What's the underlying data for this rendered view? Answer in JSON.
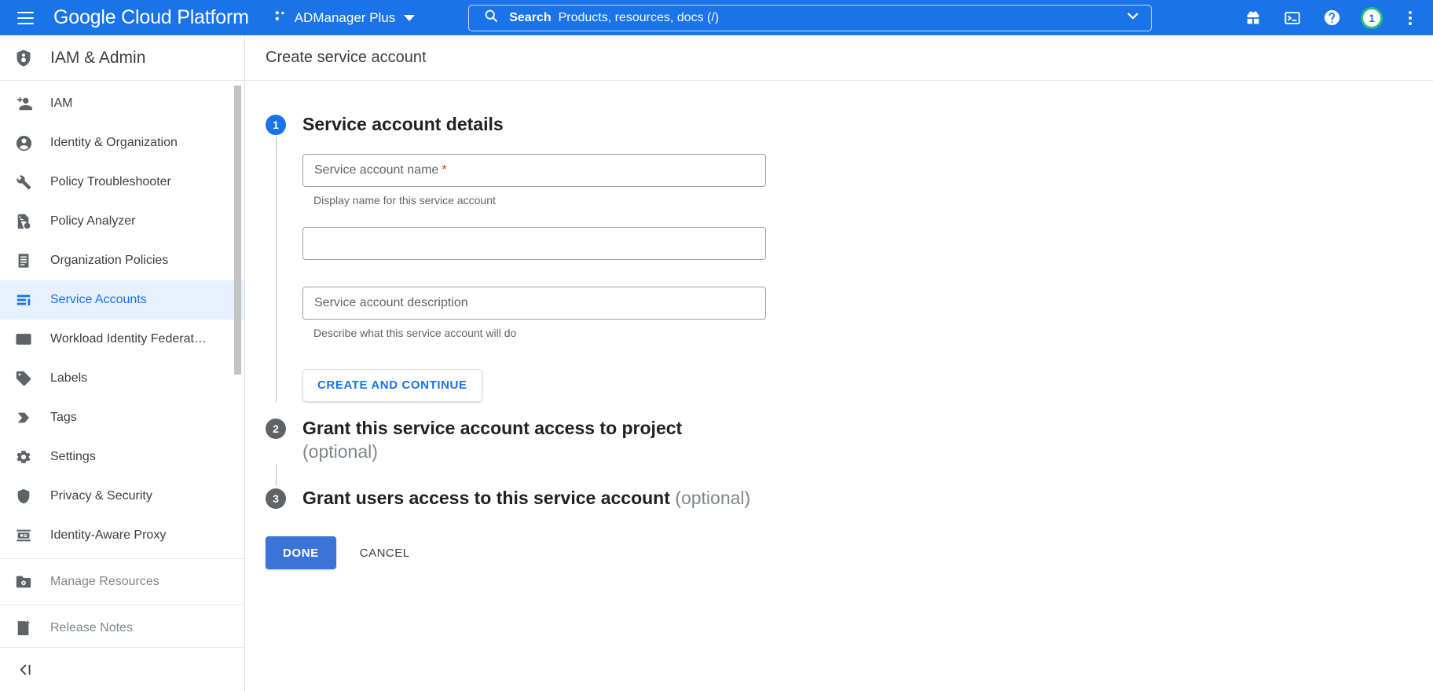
{
  "topbar": {
    "menu_icon": "hamburger-menu-icon",
    "brand": "Google Cloud Platform",
    "project": {
      "icon": "project-selector-icon",
      "name": "ADManager Plus",
      "caret": "chevron-down-icon"
    },
    "search": {
      "icon": "search-icon",
      "label": "Search",
      "placeholder": "Products, resources, docs (/)",
      "dropdown_icon": "chevron-down-icon"
    },
    "icons": [
      {
        "name": "gift-icon"
      },
      {
        "name": "cloud-shell-terminal-icon"
      },
      {
        "name": "help-icon"
      },
      {
        "name": "more-options-kebab-icon"
      }
    ],
    "avatar": {
      "name": "account-avatar",
      "text": "1",
      "ring_color": "#24c277"
    }
  },
  "sidebar": {
    "header": {
      "icon": "iam-shield-icon",
      "title": "IAM & Admin"
    },
    "items": [
      {
        "label": "IAM",
        "icon": "person-add-icon",
        "state": "normal"
      },
      {
        "label": "Identity & Organization",
        "icon": "account-circle-icon",
        "state": "normal"
      },
      {
        "label": "Policy Troubleshooter",
        "icon": "wrench-icon",
        "state": "normal"
      },
      {
        "label": "Policy Analyzer",
        "icon": "policy-document-icon",
        "state": "normal"
      },
      {
        "label": "Organization Policies",
        "icon": "list-document-icon",
        "state": "normal"
      },
      {
        "label": "Service Accounts",
        "icon": "key-card-icon",
        "state": "active"
      },
      {
        "label": "Workload Identity Federat…",
        "icon": "id-card-icon",
        "state": "normal"
      },
      {
        "label": "Labels",
        "icon": "label-tag-icon",
        "state": "normal"
      },
      {
        "label": "Tags",
        "icon": "tag-chevron-icon",
        "state": "normal"
      },
      {
        "label": "Settings",
        "icon": "gear-icon",
        "state": "normal"
      },
      {
        "label": "Privacy & Security",
        "icon": "shield-icon",
        "state": "normal"
      },
      {
        "label": "Identity-Aware Proxy",
        "icon": "iap-frame-icon",
        "state": "normal"
      },
      {
        "label": "Manage Resources",
        "icon": "folder-gear-icon",
        "state": "muted",
        "divider_before": true
      },
      {
        "label": "Release Notes",
        "icon": "release-notes-icon",
        "state": "muted",
        "divider_before": true
      }
    ],
    "footer": {
      "collapse_icon": "collapse-panel-icon",
      "collapse_glyph": "❮|"
    }
  },
  "page": {
    "title": "Create service account",
    "steps": [
      {
        "number": "1",
        "title": "Service account details",
        "badge_color": "#1a73e8"
      },
      {
        "number": "2",
        "title": "Grant this service account access to project",
        "optional": "(optional)",
        "badge_color": "#5f6368"
      },
      {
        "number": "3",
        "title": "Grant users access to this service account",
        "optional": "(optional)",
        "badge_color": "#5f6368"
      }
    ],
    "form": {
      "name_field": {
        "placeholder": "Service account name",
        "required_mark": "*",
        "value": "",
        "helper": "Display name for this service account"
      },
      "id_field": {
        "placeholder": "",
        "value": "",
        "helper": ""
      },
      "description_field": {
        "placeholder": "Service account description",
        "value": "",
        "helper": "Describe what this service account will do"
      },
      "create_continue_label": "CREATE AND CONTINUE"
    },
    "actions": {
      "done_label": "DONE",
      "cancel_label": "CANCEL"
    }
  },
  "colors": {
    "brand_blue": "#1a73e8",
    "primary_button": "#3c73d9",
    "active_item_bg": "#e8f0fe",
    "required_red": "#d93025"
  }
}
